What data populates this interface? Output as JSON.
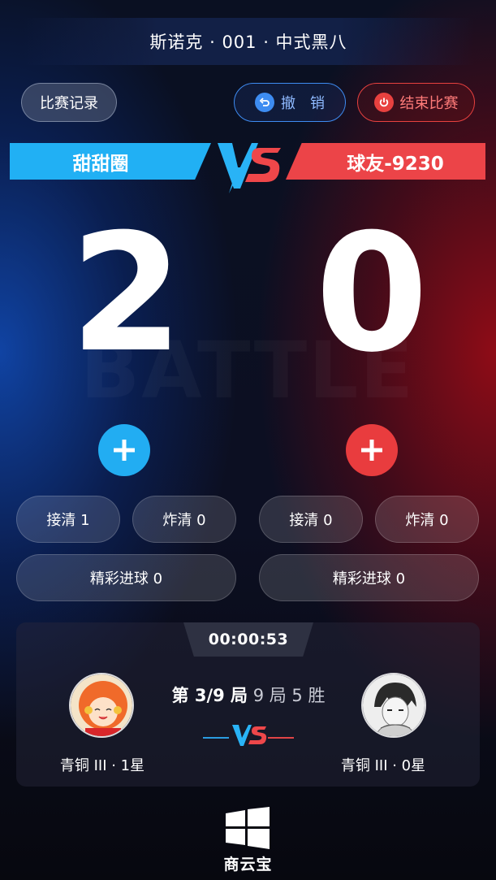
{
  "header": {
    "title": "斯诺克 · 001 · 中式黑八"
  },
  "toolbar": {
    "records_label": "比赛记录",
    "undo_label": "撤　销",
    "end_label": "结束比赛"
  },
  "teams": {
    "left": {
      "name": "甜甜圈",
      "color": "#21b0f4",
      "score": "2"
    },
    "right": {
      "name": "球友-9230",
      "color": "#ec4448",
      "score": "0"
    }
  },
  "watermark": "BATTLE",
  "stats": {
    "left": {
      "clear": "接清 1",
      "break_clear": "炸清 0",
      "highlight": "精彩进球 0"
    },
    "right": {
      "clear": "接清 0",
      "break_clear": "炸清 0",
      "highlight": "精彩进球 0"
    }
  },
  "match": {
    "timer": "00:00:53",
    "round_current": "第 3/9 局",
    "round_rule": "9 局 5 胜",
    "left_rank": "青铜 III · 1星",
    "right_rank": "青铜 III · 0星"
  },
  "brand": {
    "name": "商云宝"
  },
  "icons": {
    "undo": "undo-icon",
    "power": "power-icon",
    "plus": "plus-icon",
    "vs": "vs-icon",
    "brand": "windows-logo-icon"
  }
}
